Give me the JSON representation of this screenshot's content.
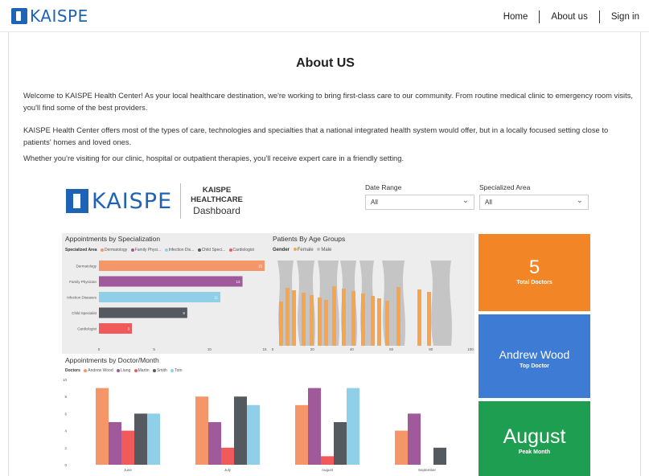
{
  "nav": {
    "brand": "KAISPE",
    "links": [
      "Home",
      "About us",
      "Sign in"
    ]
  },
  "page": {
    "title": "About US",
    "paragraphs": [
      "Welcome to KAISPE Health Center! As your local healthcare destination, we're working to bring first-class care to our community. From routine medical clinic to emergency room visits, you'll find some of the best providers.",
      "KAISPE Health Center offers most of the types of care, technologies and specialties that a national integrated health system would offer, but in a locally focused  setting close to patients' homes and loved ones.",
      "Whether you're visiting for our clinic, hospital or outpatient therapies, you'll receive expert care in a friendly setting."
    ]
  },
  "dashboard": {
    "brand": "KAISPE",
    "title_line1": "KAISPE",
    "title_line2": "HEALTHCARE",
    "title_line3": "Dashboard",
    "filters": [
      {
        "label": "Date Range",
        "value": "All"
      },
      {
        "label": "Specialized Area",
        "value": "All"
      }
    ],
    "cards": [
      {
        "value": "5",
        "caption": "Total Doctors",
        "color": "#f28627"
      },
      {
        "value": "Andrew Wood",
        "caption": "Top Doctor",
        "color": "#3d7bd4"
      },
      {
        "value": "August",
        "caption": "Peak Month",
        "color": "#1e9e50"
      }
    ]
  },
  "chart_data": [
    {
      "type": "bar",
      "orientation": "horizontal",
      "title": "Appointments by Specialization",
      "legend_title": "Specialized Area",
      "legend": [
        "Dermatology",
        "Family Physi...",
        "Infection Dis...",
        "Child Speci...",
        "Cardiologist"
      ],
      "categories": [
        "Dermatology",
        "Family Physician",
        "Infection Diseases",
        "Child Specialist",
        "Cardiologist"
      ],
      "values": [
        15,
        13,
        11,
        8,
        3
      ],
      "colors": [
        "#f4956a",
        "#a05a9c",
        "#8fcfe8",
        "#555a60",
        "#f05a5a"
      ],
      "xlim": [
        0,
        15
      ],
      "xticks": [
        "0",
        "5",
        "10",
        "15"
      ]
    },
    {
      "type": "bar",
      "title": "Patients By Age Groups",
      "legend_title": "Gender",
      "legend": [
        "Female",
        "Male"
      ],
      "colors": [
        "#f6a54e",
        "#bdbdbd"
      ],
      "xlim": [
        0,
        100
      ],
      "xticks": [
        "0",
        "20",
        "40",
        "60",
        "80",
        "100"
      ]
    },
    {
      "type": "bar",
      "title": "Appointments by Doctor/Month",
      "legend_title": "Doctors",
      "categories": [
        "June",
        "July",
        "August",
        "September"
      ],
      "series": [
        {
          "name": "Andrew Wood",
          "color": "#f4956a",
          "values": [
            9,
            8,
            7,
            4
          ]
        },
        {
          "name": "Liang",
          "color": "#a05a9c",
          "values": [
            5,
            5,
            9,
            6
          ]
        },
        {
          "name": "Martin",
          "color": "#f05a5a",
          "values": [
            4,
            2,
            1,
            0
          ]
        },
        {
          "name": "Smith",
          "color": "#555a60",
          "values": [
            6,
            8,
            5,
            2
          ]
        },
        {
          "name": "Tom",
          "color": "#8fcfe8",
          "values": [
            6,
            7,
            9,
            0
          ]
        }
      ],
      "yticks": [
        "0",
        "2",
        "4",
        "6",
        "8",
        "10"
      ],
      "ylim": [
        0,
        10
      ]
    }
  ]
}
